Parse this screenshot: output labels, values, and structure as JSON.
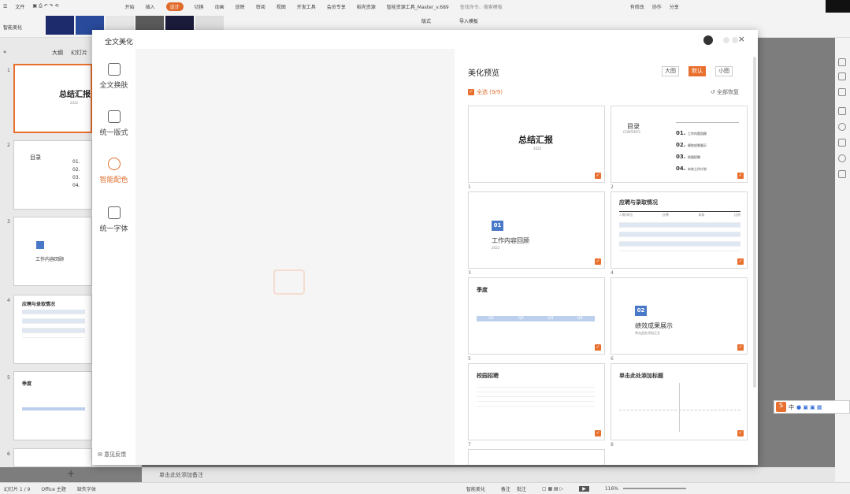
{
  "menubar": {
    "file": "文件",
    "tabs": [
      "开始",
      "插入",
      "设计",
      "切换",
      "动画",
      "放映",
      "审阅",
      "视图",
      "开发工具",
      "会员专享",
      "稻壳资源",
      "智能资源工具_Master_v.689"
    ],
    "active_tab": "设计",
    "search_placeholder": "查找命令、搜索模板",
    "right": [
      "有修改",
      "协作",
      "分享"
    ]
  },
  "ribbon": {
    "smart_beautify": "智能美化",
    "layout": "版式",
    "import_template": "导入模板"
  },
  "left_pane": {
    "tabs": [
      "大纲",
      "幻灯片"
    ],
    "slides": [
      {
        "num": "1",
        "title": "总结汇报",
        "sub": "2022"
      },
      {
        "num": "2",
        "title": "目录",
        "items": [
          "01.",
          "02.",
          "03.",
          "04."
        ]
      },
      {
        "num": "3",
        "title": "工作内容回顾"
      },
      {
        "num": "4",
        "title": "应聘与录取情况"
      },
      {
        "num": "5",
        "title": "季度"
      },
      {
        "num": "6",
        "title": ""
      }
    ],
    "add": "+"
  },
  "dialog": {
    "title": "全文美化",
    "close": "×",
    "sidebar": [
      {
        "label": "全文换肤",
        "active": false
      },
      {
        "label": "统一版式",
        "active": false
      },
      {
        "label": "智能配色",
        "active": true
      },
      {
        "label": "统一字体",
        "active": false
      }
    ],
    "feedback": "意见反馈",
    "preview": {
      "title": "美化预览",
      "size_options": [
        "大图",
        "默认",
        "小图"
      ],
      "selected_size": "默认",
      "select_all": "全选 (9/9)",
      "restore_all": "全部恢复",
      "cards": [
        {
          "num": "1",
          "title": "总结汇报",
          "sub": "2022"
        },
        {
          "num": "2",
          "title": "目录",
          "sub": "CONTENTS",
          "items": [
            "01.",
            "02.",
            "03.",
            "04."
          ],
          "item_text": [
            "工作内容回顾",
            "绩效成果展示",
            "校园招聘",
            "未来工作计划"
          ]
        },
        {
          "num": "3",
          "box": "01",
          "title": "工作内容回顾",
          "sub": "2022"
        },
        {
          "num": "4",
          "title": "应聘与录取情况",
          "headers": [
            "人数/岗位",
            "应聘",
            "录取",
            "比例"
          ]
        },
        {
          "num": "5",
          "title": "季度",
          "steps": [
            "Q1",
            "Q2",
            "Q3",
            "Q4"
          ]
        },
        {
          "num": "6",
          "box": "02",
          "title": "绩效成果展示",
          "sub": "单击此处添加正文"
        },
        {
          "num": "7",
          "title": "校园招聘"
        },
        {
          "num": "8",
          "title": "单击此处添加标题"
        }
      ],
      "next_num": "7"
    }
  },
  "notes_placeholder": "单击此处添加备注",
  "status": {
    "slide": "幻灯片 1 / 9",
    "theme": "Office 主题",
    "font": "缺失字体",
    "beautify": "智能美化",
    "notes": "备注",
    "comments": "批注",
    "zoom": "116%"
  },
  "ime": {
    "label": "中"
  }
}
